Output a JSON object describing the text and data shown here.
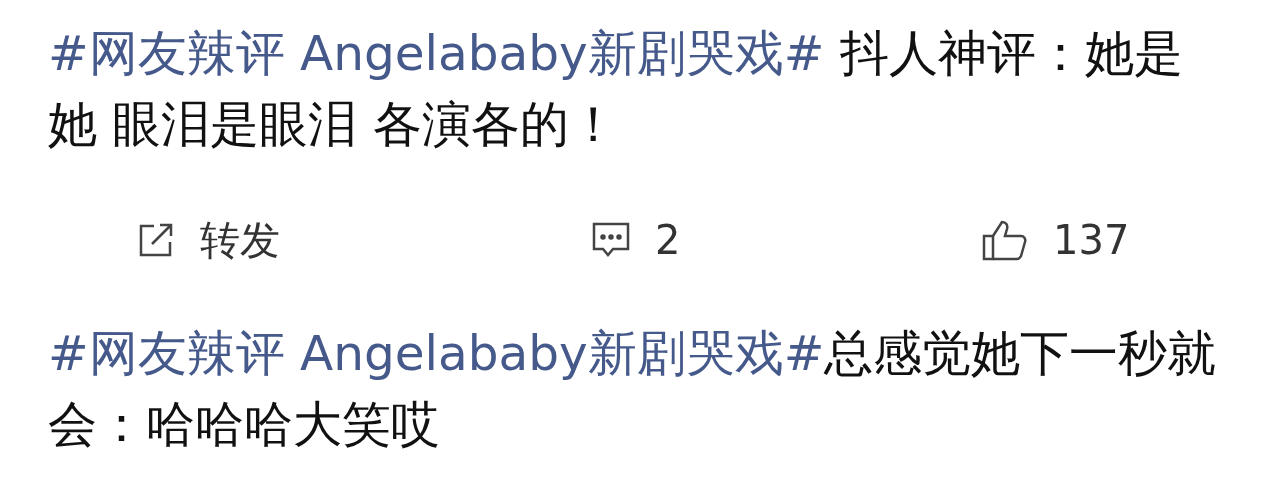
{
  "posts": [
    {
      "hashtag": "#网友辣评 Angelababy新剧哭戏#",
      "text": " 抖人神评：她是她 眼泪是眼泪 各演各的！",
      "actions": [
        {
          "kind": "repost",
          "label": "转发"
        },
        {
          "kind": "comment",
          "label": "2"
        },
        {
          "kind": "like",
          "label": "137"
        }
      ]
    },
    {
      "hashtag": "#网友辣评 Angelababy新剧哭戏#",
      "text": "总感觉她下一秒就会：哈哈哈大笑哎"
    }
  ]
}
